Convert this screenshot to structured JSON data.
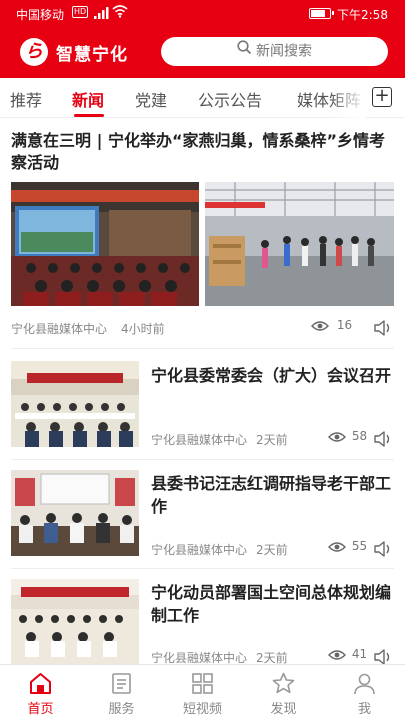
{
  "status_bar": {
    "carrier": "中国移动",
    "hd": "HD",
    "signal": "⁴⁶",
    "time": "下午2:58",
    "battery_level": 0.85
  },
  "header": {
    "logo_glyph": "ら",
    "app_name": "智慧宁化",
    "search_placeholder": "新闻搜索",
    "brand_color": "#e60012"
  },
  "tabs": [
    {
      "label": "推荐",
      "active": false
    },
    {
      "label": "新闻",
      "active": true
    },
    {
      "label": "党建",
      "active": false
    },
    {
      "label": "公示公告",
      "active": false
    },
    {
      "label": "媒体矩阵",
      "active": false
    }
  ],
  "add_tab_icon": "plus-square-icon",
  "articles": [
    {
      "title": "满意在三明 | 宁化举办“家燕归巢，情系桑梓”乡情考察活动",
      "source": "宁化县融媒体中心",
      "time": "4小时前",
      "views": "16"
    },
    {
      "title": "宁化县委常委会（扩大）会议召开",
      "source": "宁化县融媒体中心",
      "time": "2天前",
      "views": "58"
    },
    {
      "title": "县委书记汪志红调研指导老干部工作",
      "source": "宁化县融媒体中心",
      "time": "2天前",
      "views": "55"
    },
    {
      "title": "宁化动员部署国土空间总体规划编制工作",
      "source": "宁化县融媒体中心",
      "time": "2天前",
      "views": "41"
    }
  ],
  "bottom_nav": [
    {
      "label": "首页",
      "icon": "home-icon",
      "active": true
    },
    {
      "label": "服务",
      "icon": "service-icon",
      "active": false
    },
    {
      "label": "短视频",
      "icon": "grid-icon",
      "active": false
    },
    {
      "label": "发现",
      "icon": "star-icon",
      "active": false
    },
    {
      "label": "我",
      "icon": "user-icon",
      "active": false
    }
  ]
}
